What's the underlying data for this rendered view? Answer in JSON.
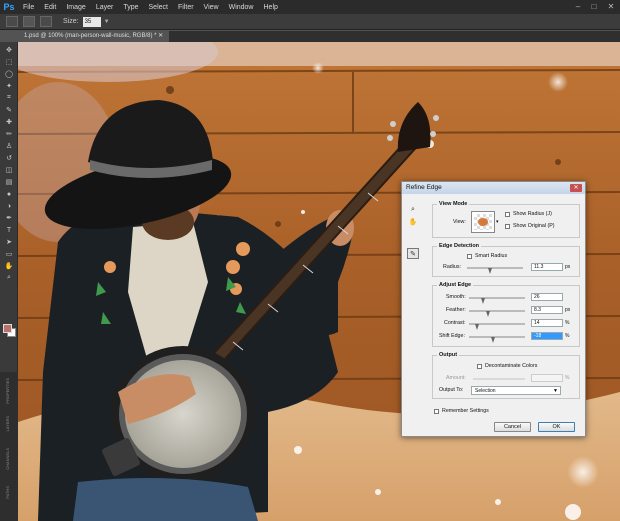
{
  "app": {
    "logo": "Ps"
  },
  "menu": [
    "File",
    "Edit",
    "Image",
    "Layer",
    "Type",
    "Select",
    "Filter",
    "View",
    "Window",
    "Help"
  ],
  "window_controls": {
    "minimize": "–",
    "maximize": "□",
    "close": "✕"
  },
  "options_bar": {
    "size_label": "Size:",
    "size_value": "35"
  },
  "document_tab": "1.psd @ 100% (man-person-wall-music, RGB/8) * ✕",
  "toolbar_icons": [
    "move-icon",
    "marquee-icon",
    "lasso-icon",
    "quick-select-icon",
    "crop-icon",
    "eyedropper-icon",
    "healing-brush-icon",
    "brush-icon",
    "clone-stamp-icon",
    "history-brush-icon",
    "eraser-icon",
    "gradient-icon",
    "blur-icon",
    "dodge-icon",
    "pen-icon",
    "type-icon",
    "path-select-icon",
    "shape-icon",
    "hand-icon",
    "zoom-icon"
  ],
  "toolbar_glyphs": [
    "✥",
    "⬚",
    "◯",
    "✦",
    "⌗",
    "✎",
    "✚",
    "✏",
    "♙",
    "↺",
    "◫",
    "▤",
    "●",
    "◑",
    "✒",
    "T",
    "➤",
    "▭",
    "✋",
    "⌕"
  ],
  "colors": {
    "foreground": "#b7726a",
    "background": "#ffffff",
    "accent": "#3399ff"
  },
  "side_panel_labels": [
    "PROPERTIES",
    "LAYERS",
    "CHANNELS",
    "PATHS"
  ],
  "dialog": {
    "title": "Refine Edge",
    "close": "✕",
    "view_mode": {
      "title": "View Mode",
      "view_label": "View:",
      "show_radius": "Show Radius (J)",
      "show_original": "Show Original (P)"
    },
    "edge_detection": {
      "title": "Edge Detection",
      "smart_radius": "Smart Radius",
      "radius_label": "Radius:",
      "radius_value": "11.3",
      "radius_unit": "px"
    },
    "adjust_edge": {
      "title": "Adjust Edge",
      "smooth_label": "Smooth:",
      "smooth_value": "26",
      "feather_label": "Feather:",
      "feather_value": "8.3",
      "feather_unit": "px",
      "contrast_label": "Contrast:",
      "contrast_value": "14",
      "contrast_unit": "%",
      "shift_label": "Shift Edge:",
      "shift_value": "-18",
      "shift_unit": "%"
    },
    "output": {
      "title": "Output",
      "decontaminate": "Decontaminate Colors",
      "amount_label": "Amount:",
      "amount_unit": "%",
      "output_to_label": "Output To:",
      "output_to_value": "Selection"
    },
    "remember_settings": "Remember Settings",
    "cancel": "Cancel",
    "ok": "OK"
  }
}
